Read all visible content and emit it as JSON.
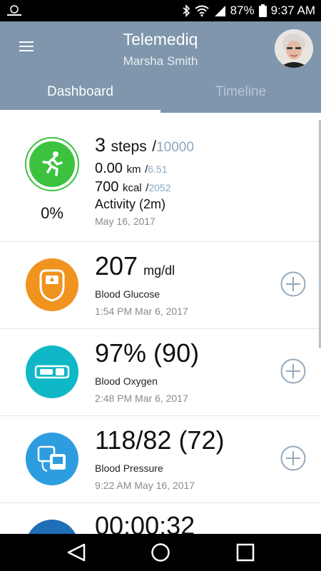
{
  "status_bar": {
    "battery": "87%",
    "time": "9:37 AM",
    "icons": [
      "app-icon",
      "bluetooth-icon",
      "wifi-icon",
      "signal-icon",
      "battery-icon"
    ]
  },
  "header": {
    "app_title": "Telemediq",
    "user_name": "Marsha Smith",
    "tabs": [
      {
        "label": "Dashboard"
      },
      {
        "label": "Timeline"
      }
    ]
  },
  "activity": {
    "steps": "3",
    "steps_label": "steps",
    "steps_goal": "10000",
    "distance": "0.00",
    "distance_unit": "km",
    "distance_goal": "6.51",
    "calories": "700",
    "calories_unit": "kcal",
    "calories_goal": "2052",
    "activity_label": "Activity (2m)",
    "percent": "0%",
    "date": "May 16, 2017"
  },
  "metrics": [
    {
      "value": "207",
      "unit": "mg/dl",
      "label": "Blood Glucose",
      "time": "1:54 PM Mar 6, 2017",
      "color": "#f0931f"
    },
    {
      "value": "97% (90)",
      "unit": "",
      "label": "Blood Oxygen",
      "time": "2:48 PM Mar 6, 2017",
      "color": "#0fb8c7"
    },
    {
      "value": "118/82 (72)",
      "unit": "",
      "label": "Blood Pressure",
      "time": "9:22 AM May 16, 2017",
      "color": "#2e9de0"
    },
    {
      "value": "00:00:32",
      "unit": "",
      "label": "",
      "time": "",
      "color": "#1f6fb7"
    }
  ],
  "colors": {
    "header_bg": "#7f96ad",
    "activity_green": "#3cc23f",
    "add_button": "#93a9bd"
  }
}
